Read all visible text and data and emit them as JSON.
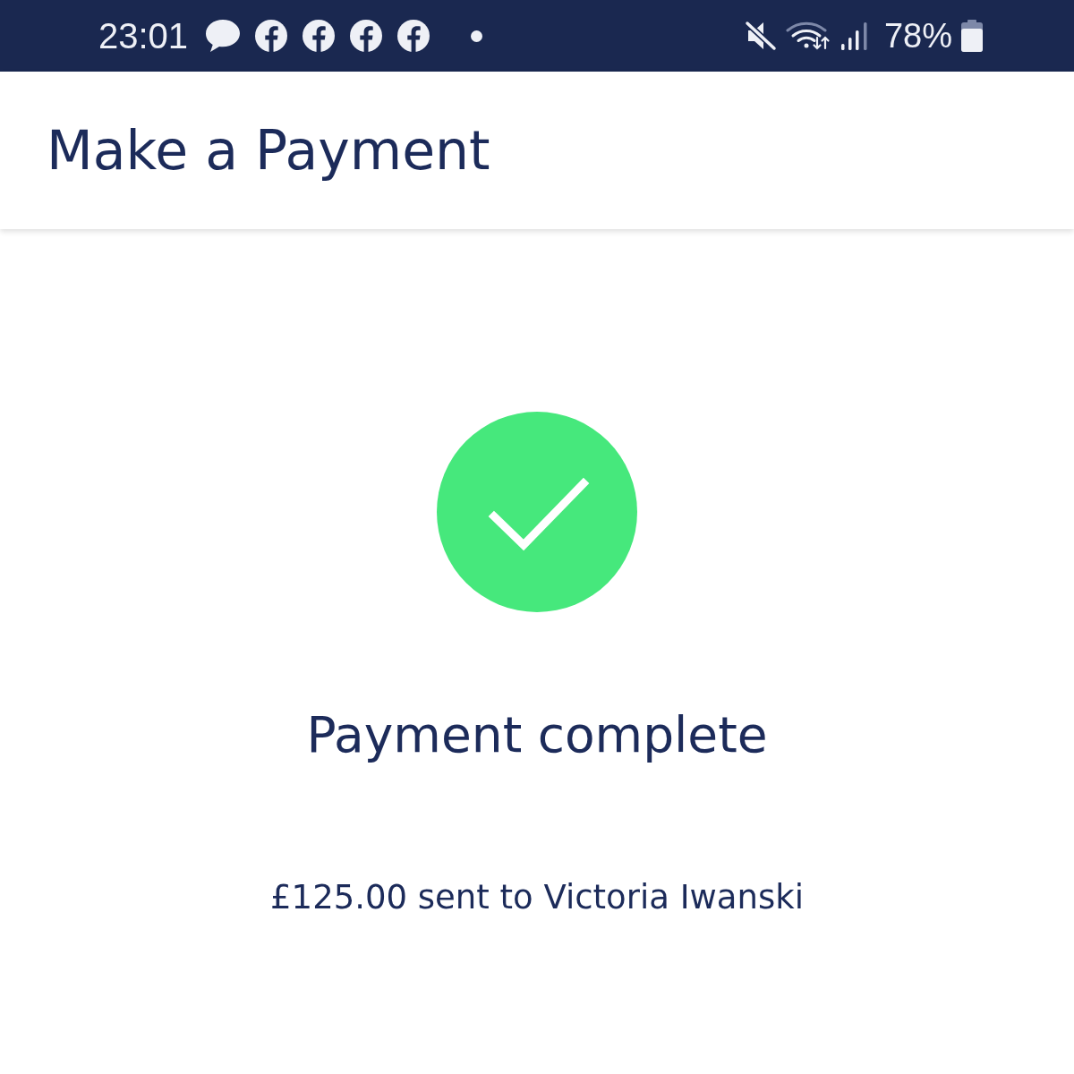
{
  "status_bar": {
    "time": "23:01",
    "battery": "78%"
  },
  "header": {
    "title": "Make a Payment"
  },
  "result": {
    "success": true,
    "title": "Payment complete",
    "message": "£125.00 sent to Victoria Iwanski"
  }
}
